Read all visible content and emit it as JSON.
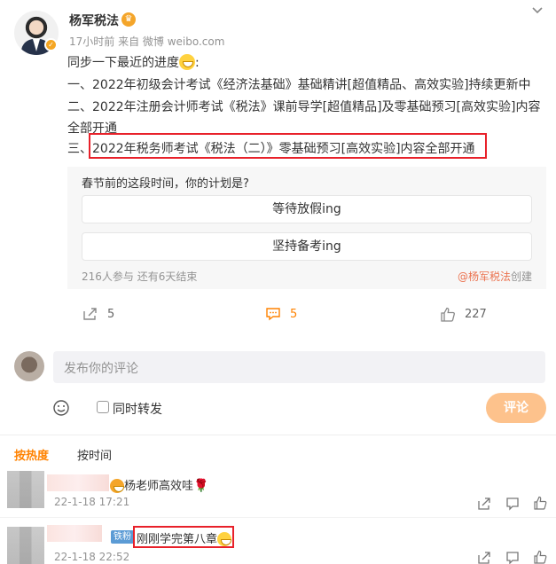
{
  "post": {
    "username": "杨军税法",
    "meta": "17小时前  来自 微博 weibo.com",
    "lines": [
      "同步一下最近的进度",
      "一、2022年初级会计考试《经济法基础》基础精讲[超值精品、高效实验]持续更新中",
      "二、2022年注册会计师考试《税法》课前导学[超值精品]及零基础预习[高效实验]内容",
      "全部开通",
      "三、",
      "2022年税务师考试《税法（二）》零基础预习[高效实验]内容全部开通"
    ],
    "line1_suffix": ":"
  },
  "poll": {
    "question": "春节前的这段时间，你的计划是?",
    "options": [
      "等待放假ing",
      "坚持备考ing"
    ],
    "stats": "216人参与  还有6天结束",
    "creator_link": "@杨军税法",
    "creator_suffix": "创建"
  },
  "actions": {
    "share": "5",
    "comment": "5",
    "like": "227"
  },
  "composer": {
    "placeholder": "发布你的评论",
    "repost_label": "同时转发",
    "submit_label": "评论"
  },
  "sort_tabs": {
    "hot": "按热度",
    "time": "按时间"
  },
  "comments": [
    {
      "text": "杨老师高效哇",
      "time": "22-1-18 17:21"
    },
    {
      "badge": "铁粉",
      "text": "刚刚学完第八章",
      "time": "22-1-18 22:52"
    }
  ],
  "colors": {
    "accent": "#ff8200",
    "highlight_border": "#e8212a",
    "link": "#eb7350",
    "submit_bg": "#fdc28c"
  }
}
